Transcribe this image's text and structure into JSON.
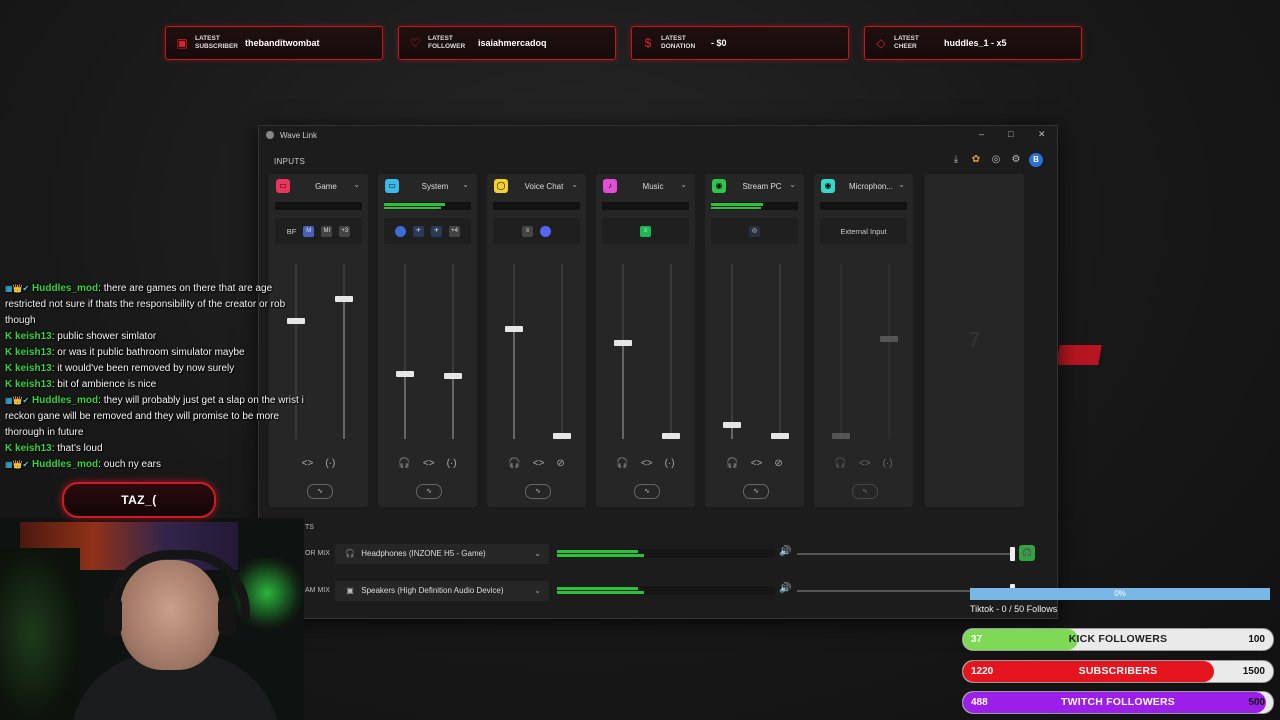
{
  "alerts": [
    {
      "icon": "twitch-icon",
      "caption": "LATEST SUBSCRIBER",
      "value": "thebanditwombat"
    },
    {
      "icon": "heart-icon",
      "caption": "LATEST FOLLOWER",
      "value": "isaiahmercadoq"
    },
    {
      "icon": "dollar-icon",
      "caption": "LATEST DONATION",
      "value": "- $0"
    },
    {
      "icon": "diamond-icon",
      "caption": "LATEST CHEER",
      "value": "huddles_1 - x5"
    }
  ],
  "wavelink": {
    "title": "Wave Link",
    "window_controls": {
      "minimize": "–",
      "maximize": "□",
      "close": "✕"
    },
    "inputs_label": "INPUTS",
    "toolbar_icons": [
      "download-icon",
      "apps-icon",
      "mixer-icon",
      "settings-icon",
      "account-icon"
    ],
    "account_initial": "B",
    "channels": [
      {
        "name": "Game",
        "color": "#e8365c",
        "apps": [
          "BF",
          "M",
          "MI",
          "+3"
        ],
        "monitor_level": 0.72,
        "stream_level": 0.8,
        "meter": 0
      },
      {
        "name": "System",
        "color": "#3fb9e8",
        "apps": [
          "+4"
        ],
        "monitor_level": 0.37,
        "stream_level": 0.36,
        "meter": 0.7
      },
      {
        "name": "Voice Chat",
        "color": "#f2d22e",
        "apps": [],
        "monitor_level": 0.63,
        "stream_level": 0.02,
        "meter": 0
      },
      {
        "name": "Music",
        "color": "#e04fd6",
        "apps": [],
        "monitor_level": 0.55,
        "stream_level": 0.02,
        "meter": 0
      },
      {
        "name": "Stream PC",
        "color": "#2fc44a",
        "apps": [],
        "monitor_level": 0.08,
        "stream_level": 0.02,
        "meter": 0.6
      },
      {
        "name": "Microphon...",
        "color": "#37d8c8",
        "apps": [
          "External Input"
        ],
        "monitor_level": 0.02,
        "stream_level": 0.57,
        "meter": 0
      }
    ],
    "add_channel_label": "7",
    "outputs": [
      {
        "label": "OR MIX",
        "device": "Headphones (INZONE H5 - Game)",
        "meter": 0.4,
        "volume": 0.98
      },
      {
        "label": "AM MIX",
        "device": "Speakers (High Definition Audio Device)",
        "meter": 0.4,
        "volume": 0.98
      }
    ],
    "outputs_label_fragment": "TS"
  },
  "chat": [
    {
      "user": "Huddles_mod",
      "mod": true,
      "message": "there are games on there that are age restricted not sure if thats the responsibility of the creator or rob though"
    },
    {
      "user": "keish13",
      "mod": false,
      "message": "public shower simlator"
    },
    {
      "user": "keish13",
      "mod": false,
      "message": "or was it public bathroom simulator maybe"
    },
    {
      "user": "keish13",
      "mod": false,
      "message": "it would've been removed by now surely"
    },
    {
      "user": "keish13",
      "mod": false,
      "message": "bit of ambience is nice"
    },
    {
      "user": "Huddles_mod",
      "mod": true,
      "message": "they will probably just get a slap on the wrist i reckon gane will be removed and they will promise to be more thorough in future"
    },
    {
      "user": "keish13",
      "mod": false,
      "message": "that's loud"
    },
    {
      "user": "Huddles_mod",
      "mod": true,
      "message": "ouch ny ears"
    }
  ],
  "streamer_name": "TAZ_(",
  "goals": {
    "tiktok": {
      "percent_label": "0%",
      "label": "Tiktok - 0 / 50 Follows"
    },
    "bars": [
      {
        "current": "37",
        "label": "KICK FOLLOWERS",
        "max": "100",
        "progress": 0.37,
        "color": "#7ed957"
      },
      {
        "current": "1220",
        "label": "SUBSCRIBERS",
        "max": "1500",
        "progress": 0.81,
        "color": "#e5151f"
      },
      {
        "current": "488",
        "label": "TWITCH FOLLOWERS",
        "max": "500",
        "progress": 0.976,
        "color": "#9b1fe8"
      }
    ]
  }
}
